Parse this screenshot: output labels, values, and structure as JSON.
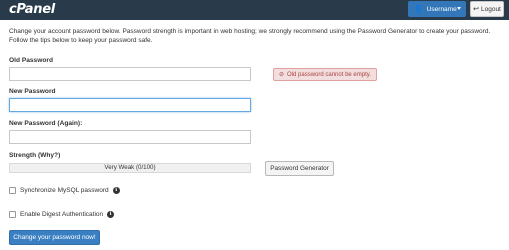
{
  "header": {
    "logo_text": "cPanel",
    "user_icon": "user-icon",
    "user_label": "Username",
    "logout_icon": "logout-icon",
    "logout_label": "Logout"
  },
  "intro_text": "Change your account password below. Password strength is important in web hosting; we strongly recommend using the Password Generator to create your password. Follow the tips below to keep your password safe.",
  "form": {
    "old_password_label": "Old Password",
    "old_password_value": "",
    "old_password_error": "Old password cannot be empty.",
    "new_password_label": "New Password",
    "new_password_value": "",
    "new_password_again_label": "New Password (Again):",
    "new_password_again_value": "",
    "strength_label": "Strength (Why?)",
    "strength_text": "Very Weak (0/100)",
    "strength_percent": 0,
    "generator_label": "Password Generator",
    "sync_mysql_label": "Synchronize MySQL password",
    "sync_mysql_checked": false,
    "digest_auth_label": "Enable Digest Authentication",
    "digest_auth_checked": false,
    "submit_label": "Change your password now!"
  },
  "colors": {
    "topbar": "#293a4a",
    "primary_button": "#3a7fc1",
    "error_bg": "#f2dede",
    "error_text": "#a94442"
  }
}
